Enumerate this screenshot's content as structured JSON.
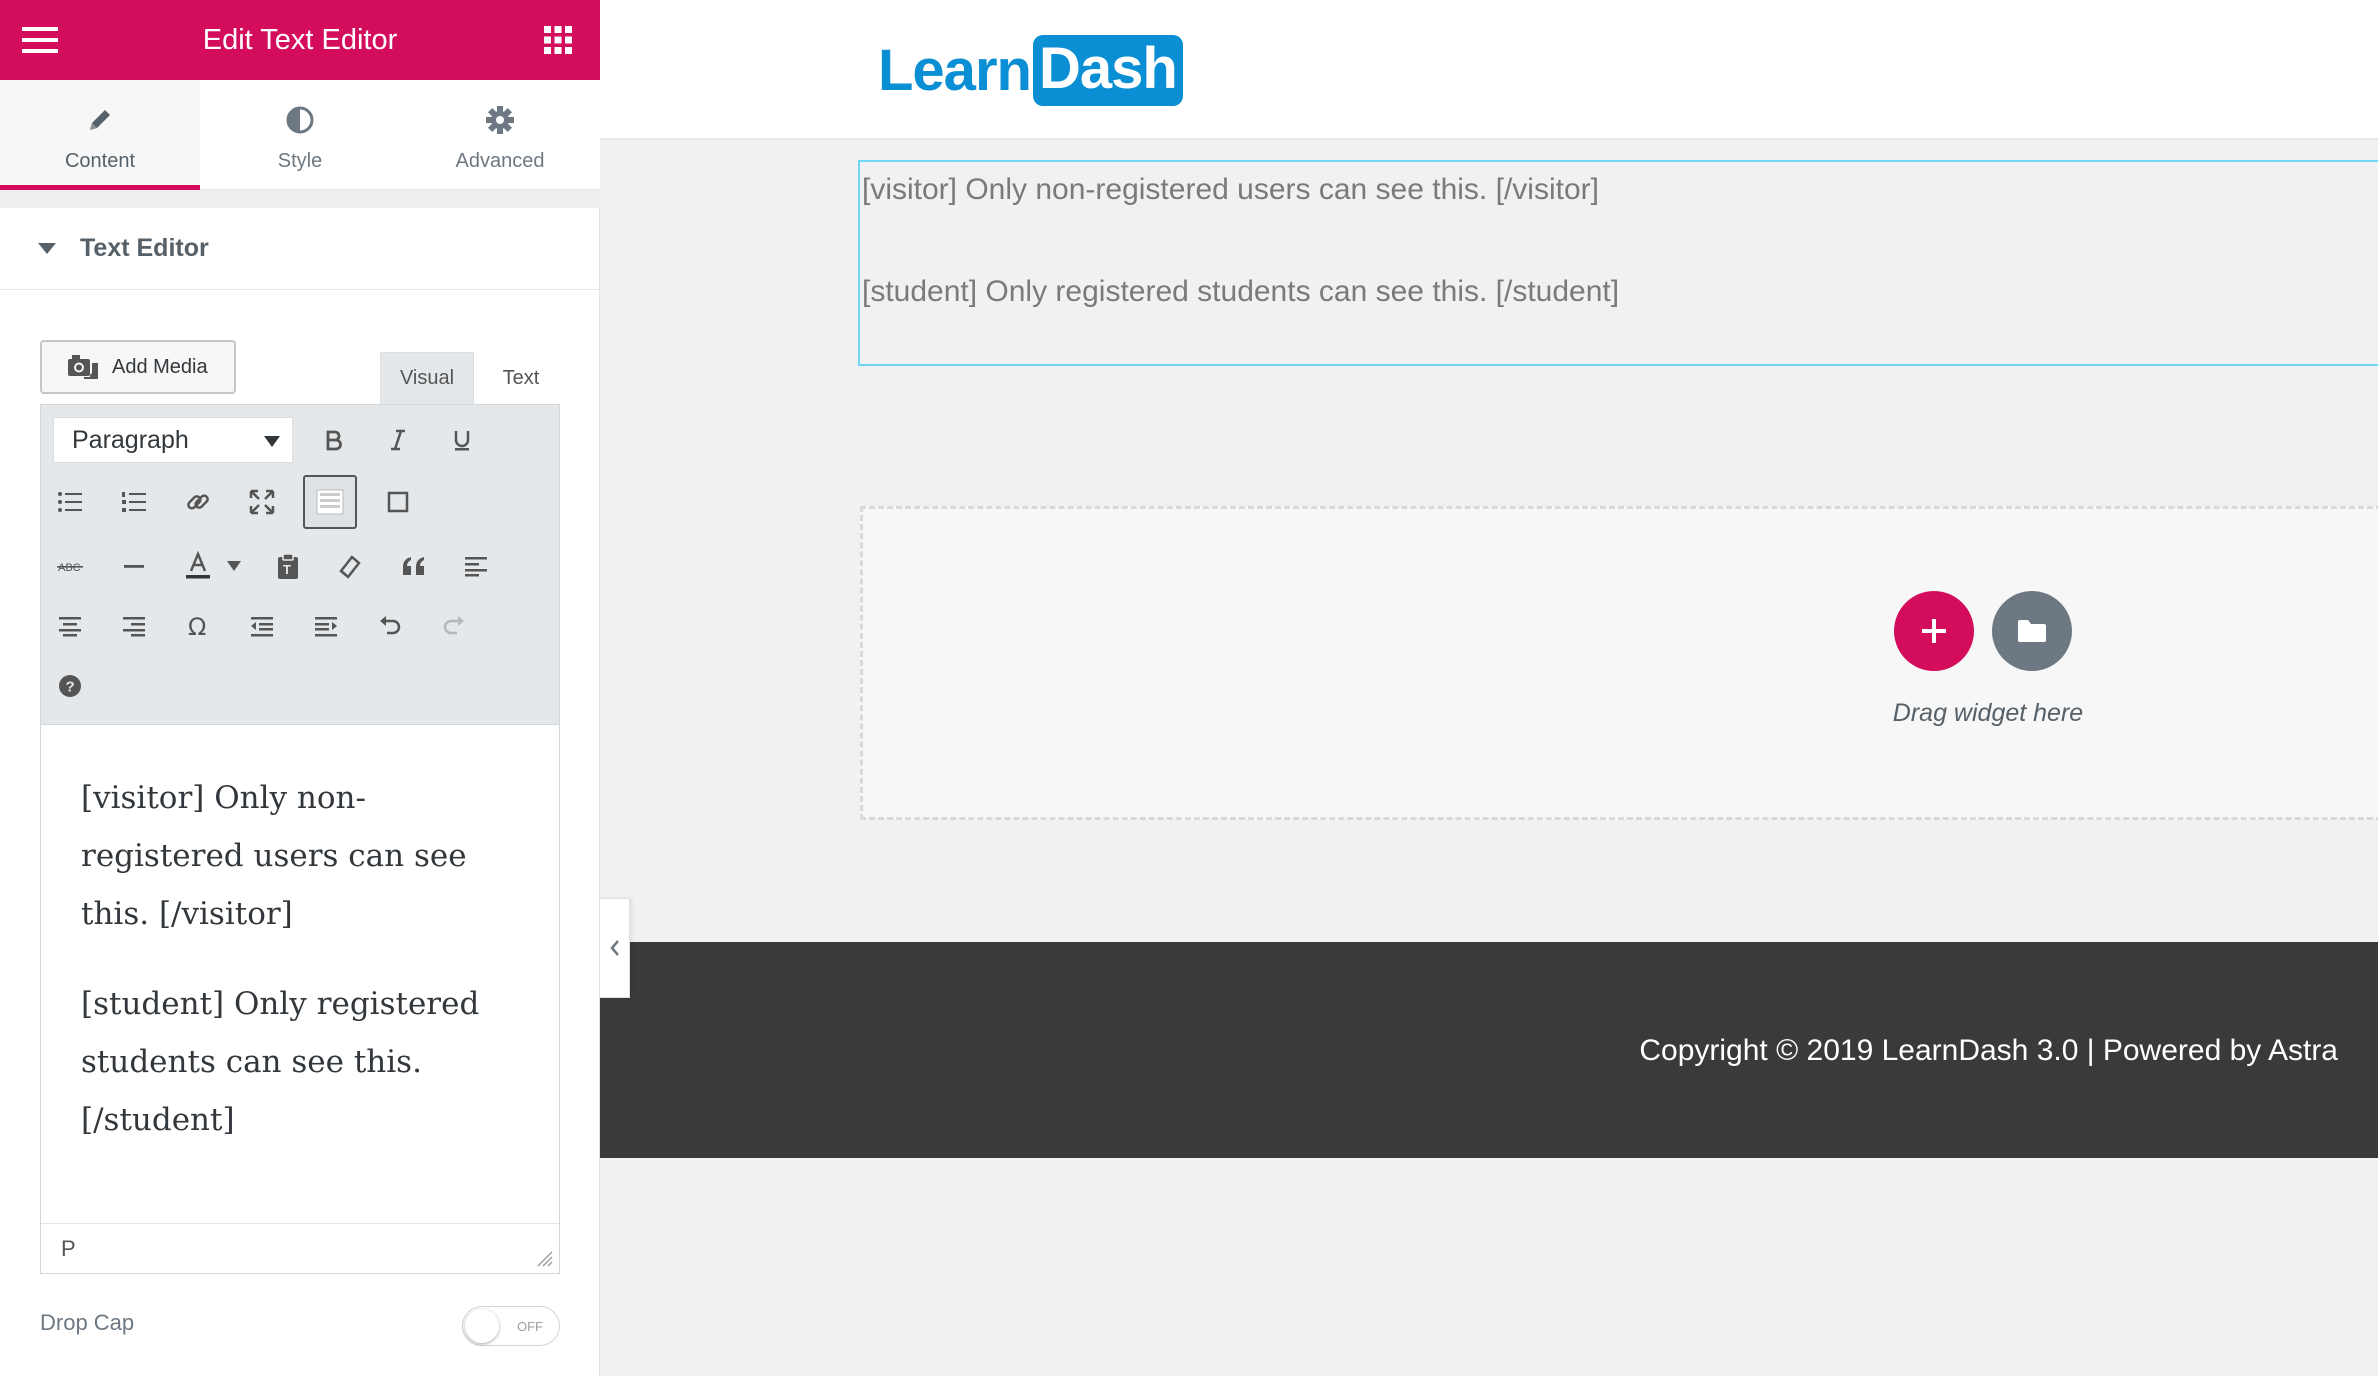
{
  "panel": {
    "title": "Edit Text Editor",
    "tabs": [
      {
        "label": "Content",
        "icon": "pencil-icon"
      },
      {
        "label": "Style",
        "icon": "half-circle-icon"
      },
      {
        "label": "Advanced",
        "icon": "gear-icon"
      }
    ],
    "section_title": "Text Editor",
    "add_media_label": "Add Media",
    "editor_tabs": {
      "visual": "Visual",
      "text": "Text"
    },
    "format_select": "Paragraph",
    "content": [
      "[visitor] Only non-registered users can see this. [/visitor]",
      "[student] Only registered students can see this. [/student]"
    ],
    "status_path": "P",
    "drop_cap_label": "Drop Cap",
    "drop_cap_state": "OFF",
    "accent_color": "#d30c5c"
  },
  "preview": {
    "logo": {
      "part1": "Learn",
      "part2": "Dash"
    },
    "widget_lines": [
      "[visitor] Only non-registered users can see this. [/visitor]",
      "[student] Only registered students can see this. [/student]"
    ],
    "drop_hint": "Drag widget here",
    "add_symbol": "+",
    "footer_text": "Copyright © 2019 LearnDash 3.0 | Powered by Astra"
  }
}
